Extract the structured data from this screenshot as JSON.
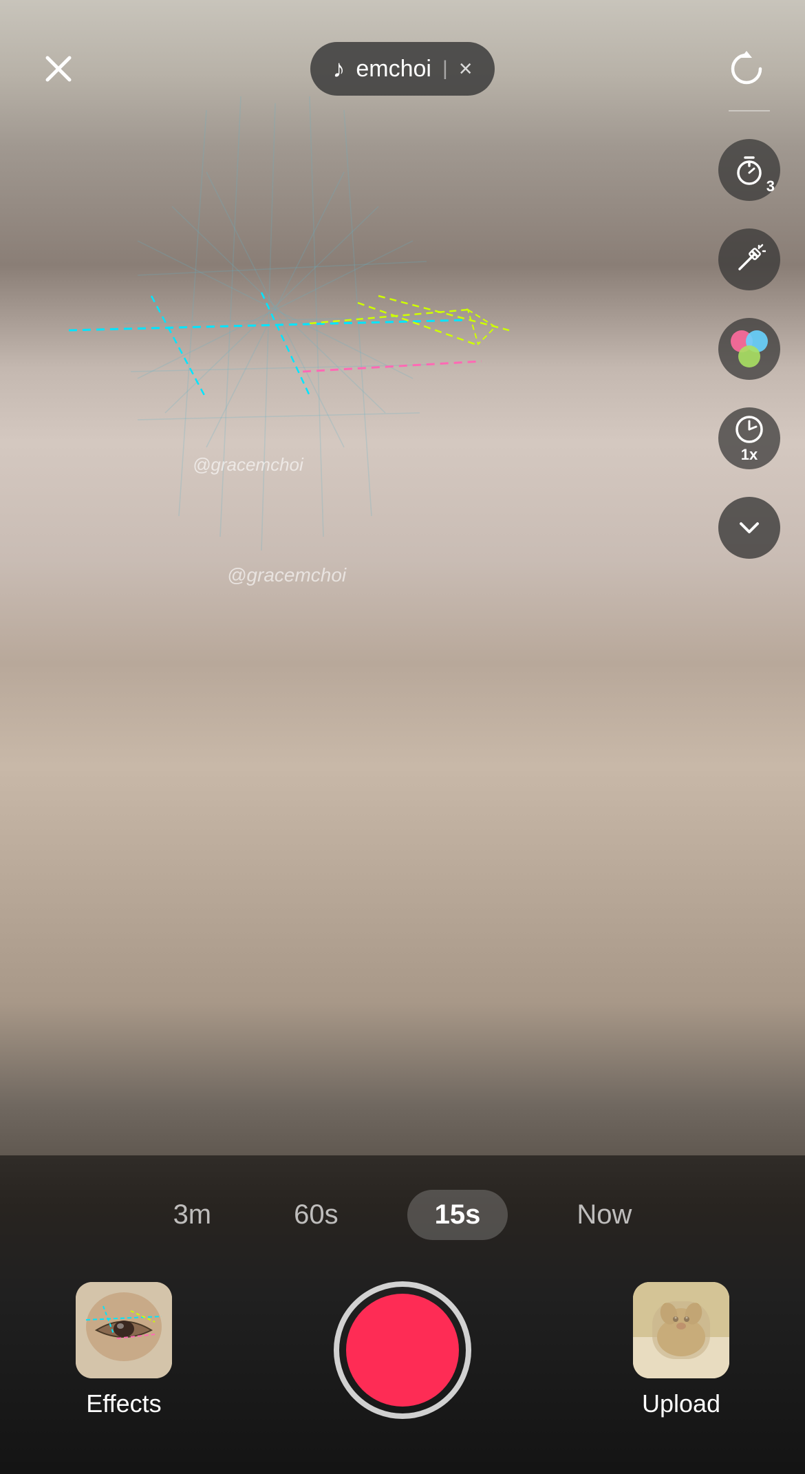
{
  "header": {
    "close_label": "×",
    "music_icon": "♪",
    "music_text": "emchoi",
    "clear_icon": "×",
    "refresh_icon": "↻"
  },
  "toolbar": {
    "timer_icon": "timer",
    "timer_badge": "3",
    "effects_icon": "sparkles",
    "colors_icon": "circles",
    "speed_icon": "speed",
    "speed_label": "1x",
    "dropdown_icon": "chevron-down"
  },
  "duration": {
    "options": [
      "3m",
      "60s",
      "15s",
      "Now"
    ],
    "active_index": 2
  },
  "bottom": {
    "effects_label": "Effects",
    "upload_label": "Upload",
    "record_button_label": "Record"
  },
  "ar_overlay": {
    "watermark": "@gracemchoi"
  }
}
